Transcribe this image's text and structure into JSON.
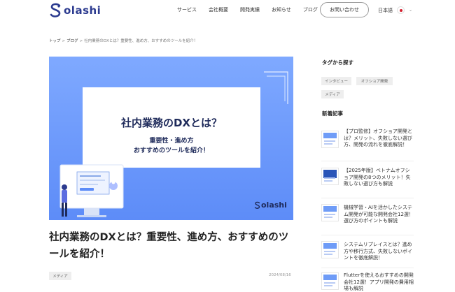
{
  "header": {
    "logo_text": "olashi",
    "nav": [
      "サービス",
      "会社概要",
      "開発実績",
      "お知らせ",
      "ブログ"
    ],
    "contact_label": "お問い合わせ",
    "language_label": "日本語"
  },
  "breadcrumb": {
    "items": [
      "トップ",
      "ブログ"
    ],
    "current": "社内業務のDXとは？重要性、進め方、おすすめのツールを紹介！",
    "separator": ">"
  },
  "hero": {
    "title": "社内業務のDXとは？",
    "subtitle_line1": "重要性・進め方",
    "subtitle_line2": "おすすめのツールを紹介！",
    "logo_text": "olashi",
    "background_color": "#6b97fa"
  },
  "article": {
    "title": "社内業務のDXとは？重要性、進め方、おすすめのツールを紹介！",
    "tag": "メディア",
    "date": "2024/08/16"
  },
  "sidebar": {
    "tags_heading": "タグから探す",
    "tags": [
      "インタビュー",
      "オフショア開発",
      "メディア"
    ],
    "news_heading": "新着記事",
    "news": [
      "【プロ監修】オフショア開発とは？メリット、失敗しない選び方、開発の流れを徹底解説！",
      "【2025年版】ベトナムオフショア開発の8つのメリット！失敗しない選び方も解説",
      "機械学習・AIを活かしたシステム開発が可能な開発会社12選！選び方のポイントも解説",
      "システムリプレイスとは？進め方や移行方式、失敗しないポイントを徹底解説！",
      "Flutterを使えるおすすめの開発会社12選！アプリ開発の費用相場も解説"
    ]
  },
  "colors": {
    "brand": "#2b3a8f",
    "flag_red": "#d3202f"
  }
}
